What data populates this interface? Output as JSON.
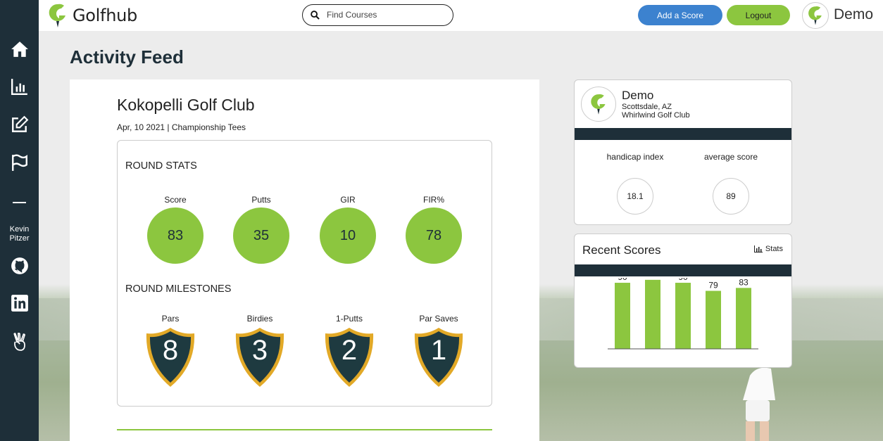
{
  "app": {
    "name": "Golfhub"
  },
  "search": {
    "placeholder": "Find Courses"
  },
  "header": {
    "add_score_label": "Add a Score",
    "logout_label": "Logout",
    "user_name": "Demo"
  },
  "sidebar": {
    "items": [
      {
        "name": "home-icon"
      },
      {
        "name": "stats-icon"
      },
      {
        "name": "edit-icon"
      },
      {
        "name": "flag-icon"
      }
    ],
    "author": "Kevin Pitzer",
    "links": [
      {
        "name": "github-icon"
      },
      {
        "name": "linkedin-icon"
      },
      {
        "name": "angellist-icon"
      }
    ]
  },
  "page": {
    "title": "Activity Feed"
  },
  "feed": {
    "course_name": "Kokopelli Golf Club",
    "meta": "Apr, 10 2021 | Championship Tees",
    "round_stats_title": "ROUND STATS",
    "round_stats": [
      {
        "label": "Score",
        "value": "83"
      },
      {
        "label": "Putts",
        "value": "35"
      },
      {
        "label": "GIR",
        "value": "10"
      },
      {
        "label": "FIR%",
        "value": "78"
      }
    ],
    "milestones_title": "ROUND MILESTONES",
    "milestones": [
      {
        "label": "Pars",
        "value": "8"
      },
      {
        "label": "Birdies",
        "value": "3"
      },
      {
        "label": "1-Putts",
        "value": "2"
      },
      {
        "label": "Par Saves",
        "value": "1"
      }
    ]
  },
  "profile": {
    "name": "Demo",
    "location": "Scottsdale, AZ",
    "club": "Whirlwind Golf Club",
    "handicap_label": "handicap index",
    "handicap_value": "18.1",
    "average_label": "average score",
    "average_value": "89"
  },
  "recent": {
    "title": "Recent Scores",
    "stats_link": "Stats"
  },
  "colors": {
    "accent_green": "#8cc63f",
    "navy": "#1e2f39",
    "blue": "#3c82cf",
    "gold": "#e2a927"
  },
  "chart_data": {
    "type": "bar",
    "categories": [
      "",
      "",
      "",
      "",
      ""
    ],
    "values": [
      90,
      94,
      90,
      79,
      83
    ],
    "ylim": [
      0,
      100
    ],
    "grid": false
  }
}
